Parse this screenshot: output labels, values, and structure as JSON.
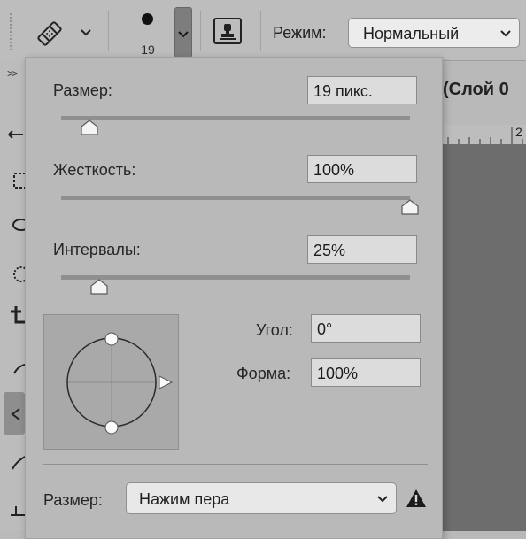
{
  "options_bar": {
    "tool_icon": "healing-brush-icon",
    "brush_size": "19",
    "clone_source_icon": "clone-stamp-icon",
    "mode_label": "Режим:",
    "mode_value": "Нормальный"
  },
  "background": {
    "collapse_glyph": ">>",
    "document_title": "(Слой 0",
    "ruler_number": "2"
  },
  "brush_panel": {
    "size_label": "Размер:",
    "size_value": "19 пикс.",
    "size_fraction": 0.08,
    "hardness_label": "Жесткость:",
    "hardness_value": "100%",
    "hardness_fraction": 1.0,
    "spacing_label": "Интервалы:",
    "spacing_value": "25%",
    "spacing_fraction": 0.11,
    "angle_label": "Угол:",
    "angle_value": "0°",
    "roundness_label": "Форма:",
    "roundness_value": "100%",
    "control_label": "Размер:",
    "control_value": "Нажим пера",
    "warning_icon": "warning-icon"
  },
  "colors": {
    "panel_bg": "#b9b9b9",
    "field_bg": "#dcdcdc",
    "canvas_bg": "#6d6d6d"
  }
}
